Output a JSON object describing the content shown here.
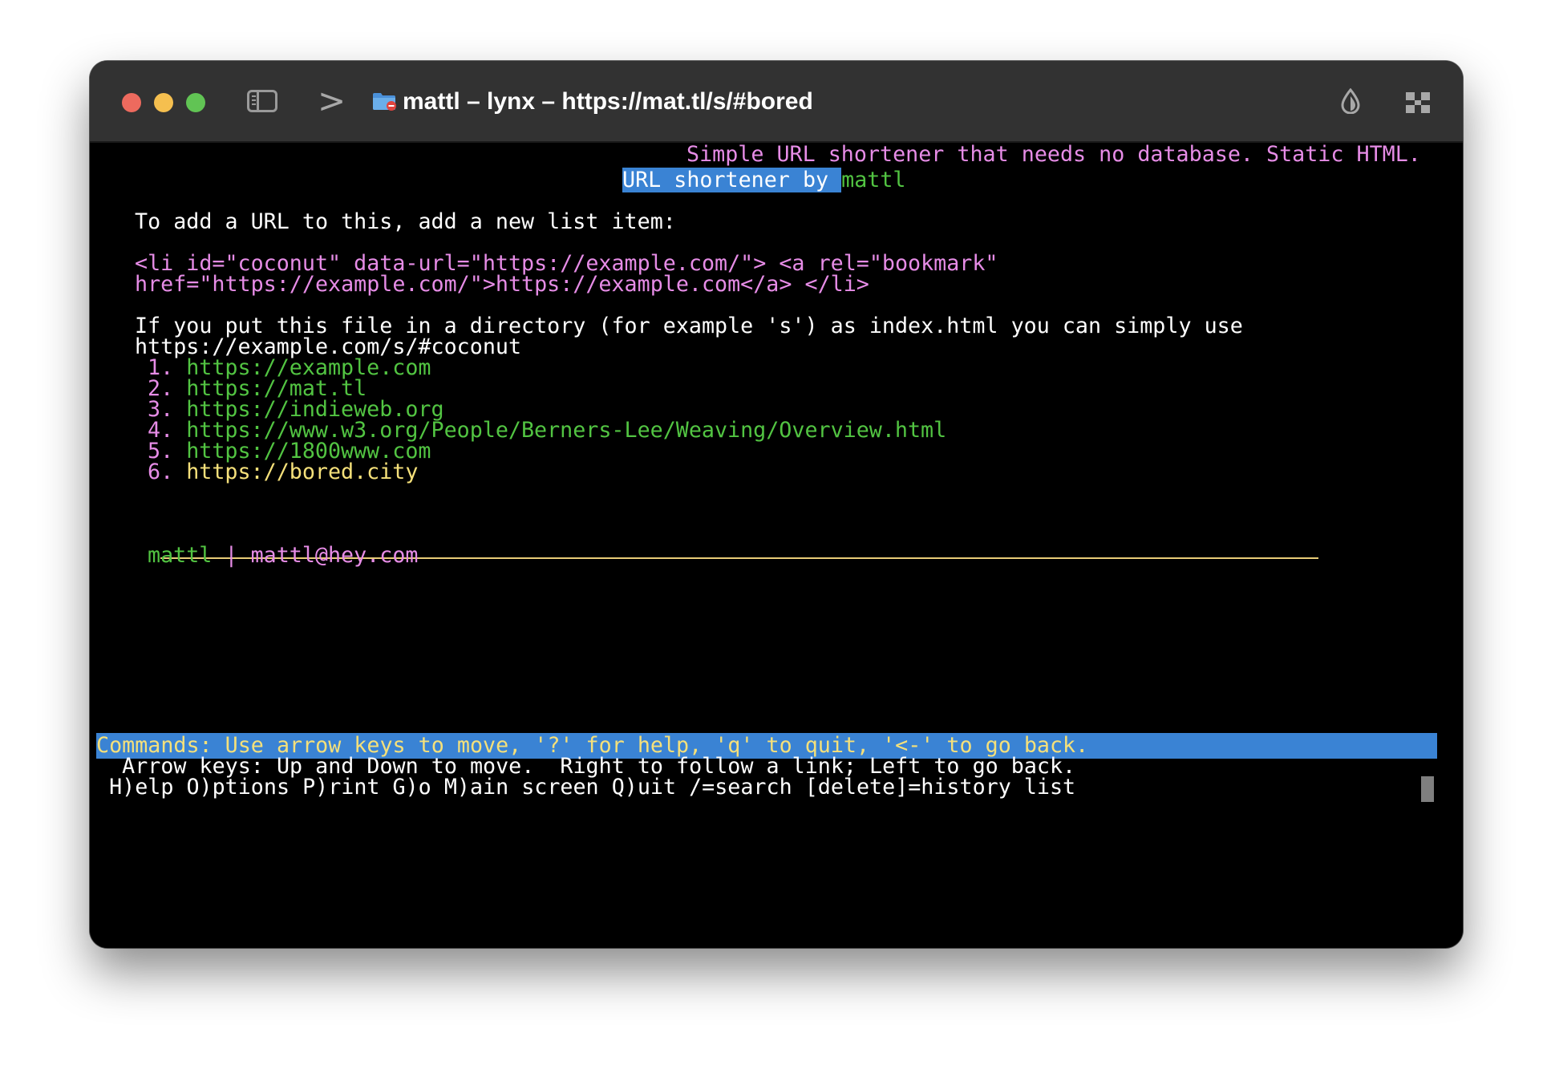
{
  "window": {
    "title": "mattl – lynx – https://mat.tl/s/#bored",
    "icons": [
      "sidebar-toggle-icon",
      "prompt-chevron-icon",
      "folder-icon",
      "drop-icon",
      "fullscreen-icon"
    ]
  },
  "page": {
    "tagline": "Simple URL shortener that needs no database. Static HTML.",
    "heading_selected": "URL shortener by ",
    "heading_link": "mattl",
    "instruction": "To add a URL to this, add a new list item:",
    "code_line_1": "<li id=\"coconut\" data-url=\"https://example.com/\"> <a rel=\"bookmark\"",
    "code_line_2": "href=\"https://example.com/\">https://example.com</a> </li>",
    "note_line_1": "If you put this file in a directory (for example 's') as index.html you can simply use",
    "note_line_2": "https://example.com/s/#coconut",
    "links": [
      {
        "num": "1.",
        "url": "https://example.com"
      },
      {
        "num": "2.",
        "url": "https://mat.tl"
      },
      {
        "num": "3.",
        "url": "https://indieweb.org"
      },
      {
        "num": "4.",
        "url": "https://www.w3.org/People/Berners-Lee/Weaving/Overview.html"
      },
      {
        "num": "5.",
        "url": "https://1800www.com"
      },
      {
        "num": "6.",
        "url": "https://bored.city"
      }
    ],
    "footer_name": "mattl",
    "footer_sep": "|",
    "footer_email": "mattl@hey.com"
  },
  "lynx": {
    "commands": "Commands: Use arrow keys to move, '?' for help, 'q' to quit, '<-' to go back.",
    "arrow_help": "  Arrow keys: Up and Down to move.  Right to follow a link; Left to go back.",
    "menu": " H)elp O)ptions P)rint G)o M)ain screen Q)uit /=search [delete]=history list"
  },
  "colors": {
    "text": "#ffffff",
    "pink": "#e68ce6",
    "green": "#52c442",
    "yellow": "#f5e07a",
    "selection": "#3a83d4",
    "rule": "#e8cc78"
  }
}
